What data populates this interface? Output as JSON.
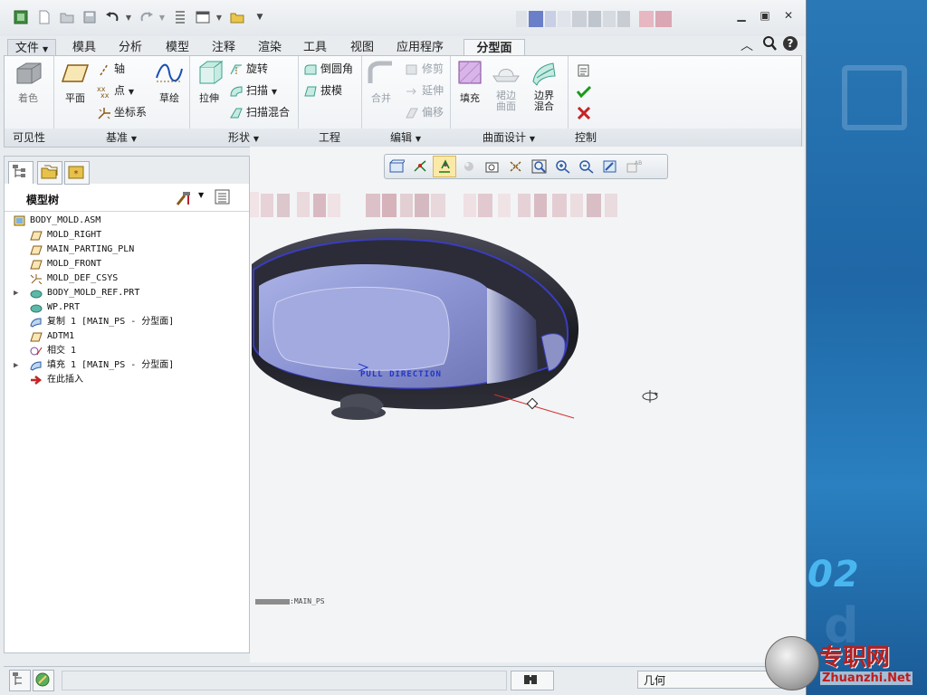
{
  "tabs": {
    "file": "文件",
    "items": [
      "模具",
      "分析",
      "模型",
      "注释",
      "渲染",
      "工具",
      "视图",
      "应用程序"
    ],
    "active": "分型面"
  },
  "ribbon": {
    "visibility": {
      "shading": "着色",
      "footer": "可见性"
    },
    "datum": {
      "plane": "平面",
      "axis": "轴",
      "point": "点",
      "csys": "坐标系",
      "footer": "基准"
    },
    "shape": {
      "sketch": "草绘",
      "extrude": "拉伸",
      "revolve": "旋转",
      "sweep": "扫描",
      "swept_blend": "扫描混合",
      "footer": "形状"
    },
    "engineering": {
      "round": "倒圆角",
      "draft": "拔模",
      "footer": "工程"
    },
    "editing": {
      "merge": "合并",
      "trim": "修剪",
      "extend": "延伸",
      "offset": "偏移",
      "footer": "编辑"
    },
    "surface": {
      "fill": "填充",
      "skirt_1": "裙边",
      "skirt_2": "曲面",
      "boundary_1": "边界",
      "boundary_2": "混合",
      "footer": "曲面设计"
    },
    "control": {
      "footer": "控制"
    }
  },
  "model_tree": {
    "title": "模型树",
    "root": "BODY_MOLD.ASM",
    "items": [
      {
        "label": "MOLD_RIGHT",
        "icon": "plane-icon",
        "expand": false
      },
      {
        "label": "MAIN_PARTING_PLN",
        "icon": "plane-icon",
        "expand": false
      },
      {
        "label": "MOLD_FRONT",
        "icon": "plane-icon",
        "expand": false
      },
      {
        "label": "MOLD_DEF_CSYS",
        "icon": "csys-icon",
        "expand": false
      },
      {
        "label": "BODY_MOLD_REF.PRT",
        "icon": "part-icon",
        "expand": true
      },
      {
        "label": "WP.PRT",
        "icon": "part-icon",
        "expand": false
      },
      {
        "label": "复制 1 [MAIN_PS - 分型面]",
        "icon": "surface-icon",
        "expand": false
      },
      {
        "label": "ADTM1",
        "icon": "plane-icon",
        "expand": false
      },
      {
        "label": "相交 1",
        "icon": "intersect-icon",
        "expand": false
      },
      {
        "label": "填充 1 [MAIN_PS - 分型面]",
        "icon": "surface-icon",
        "expand": true
      },
      {
        "label": "在此插入",
        "icon": "insert-arrow-icon",
        "expand": false
      }
    ]
  },
  "viewport": {
    "annotation": "PULL DIRECTION",
    "surface_label": "MAIN_PS"
  },
  "status": {
    "filter": "几何"
  },
  "desktop": {
    "number": "02",
    "watermark_site": "Zhuanzhi.Net"
  },
  "colors": {
    "accent_blue": "#1d5f9c",
    "model_surface": "#8d95d4",
    "model_dark": "#202129",
    "confirm_green": "#1a9a1a",
    "cancel_red": "#c42424"
  }
}
